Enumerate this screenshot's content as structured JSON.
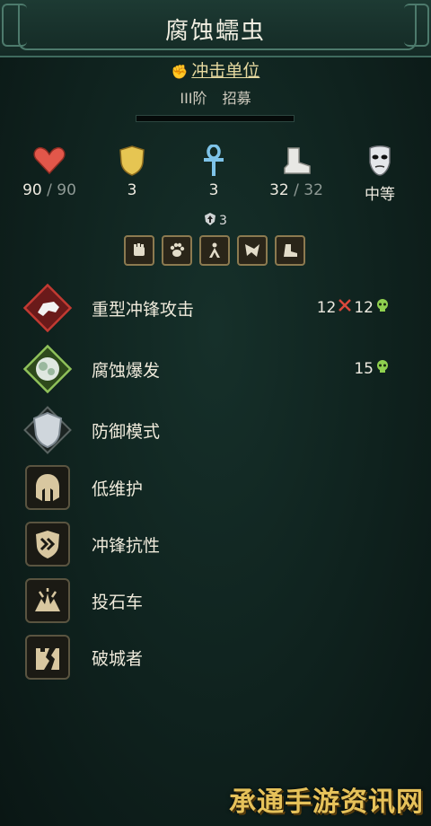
{
  "unit": {
    "name": "腐蚀蠕虫",
    "class_label": "冲击单位",
    "tier": "III阶",
    "recruit": "招募"
  },
  "stats": {
    "health": {
      "current": "90",
      "sep": " / ",
      "max": "90",
      "icon": "heart-icon"
    },
    "defense": {
      "value": "3",
      "icon": "shield-icon"
    },
    "resistance": {
      "value": "3",
      "icon": "ankh-icon"
    },
    "movement": {
      "current": "32",
      "sep": " / ",
      "max": "32",
      "icon": "boot-icon"
    },
    "morale": {
      "value": "中等",
      "icon": "mask-icon"
    }
  },
  "armor": {
    "value": "3",
    "icon": "armor-arrow-icon"
  },
  "traits": [
    "fist-trait-icon",
    "paw-trait-icon",
    "figure-trait-icon",
    "wing-trait-icon",
    "boot-trait-icon"
  ],
  "abilities": [
    {
      "name": "重型冲锋攻击",
      "damage1": "12",
      "damage2": "12"
    },
    {
      "name": "腐蚀爆发",
      "damage1": "15"
    },
    {
      "name": "防御模式"
    },
    {
      "name": "低维护"
    },
    {
      "name": "冲锋抗性"
    },
    {
      "name": "投石车"
    },
    {
      "name": "破城者"
    }
  ],
  "watermark": "承通手游资讯网",
  "colors": {
    "accent": "#e6d9a0",
    "panel": "#0f221e",
    "border": "#4d7a6c"
  }
}
